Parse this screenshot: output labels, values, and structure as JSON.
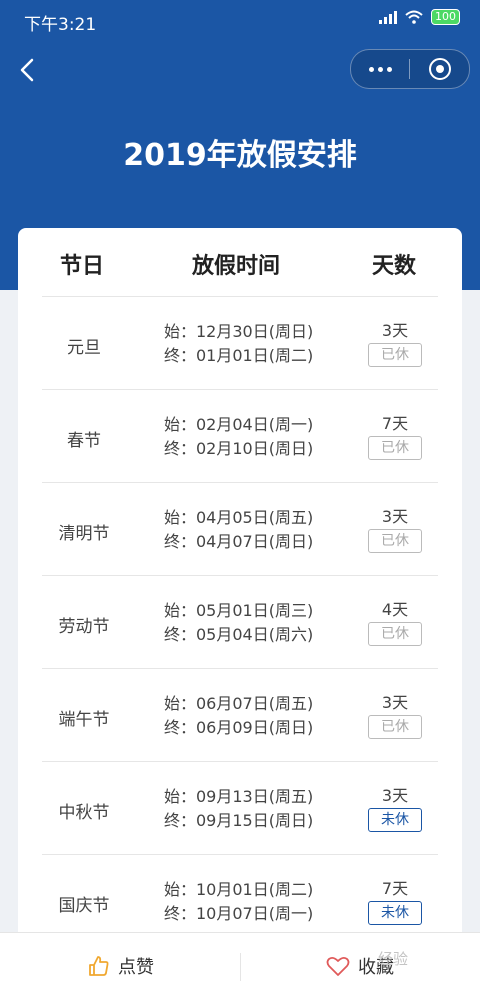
{
  "status": {
    "time": "下午3:21",
    "battery": "100"
  },
  "page": {
    "title": "2019年放假安排"
  },
  "table": {
    "headers": [
      "节日",
      "放假时间",
      "天数"
    ],
    "rows": [
      {
        "name": "元旦",
        "start": "始：12月30日(周日)",
        "end": "终：01月01日(周二)",
        "days": "3天",
        "status": "已休",
        "pending": false
      },
      {
        "name": "春节",
        "start": "始：02月04日(周一)",
        "end": "终：02月10日(周日)",
        "days": "7天",
        "status": "已休",
        "pending": false
      },
      {
        "name": "清明节",
        "start": "始：04月05日(周五)",
        "end": "终：04月07日(周日)",
        "days": "3天",
        "status": "已休",
        "pending": false
      },
      {
        "name": "劳动节",
        "start": "始：05月01日(周三)",
        "end": "终：05月04日(周六)",
        "days": "4天",
        "status": "已休",
        "pending": false
      },
      {
        "name": "端午节",
        "start": "始：06月07日(周五)",
        "end": "终：06月09日(周日)",
        "days": "3天",
        "status": "已休",
        "pending": false
      },
      {
        "name": "中秋节",
        "start": "始：09月13日(周五)",
        "end": "终：09月15日(周日)",
        "days": "3天",
        "status": "未休",
        "pending": true
      },
      {
        "name": "国庆节",
        "start": "始：10月01日(周二)",
        "end": "终：10月07日(周一)",
        "days": "7天",
        "status": "未休",
        "pending": true
      }
    ]
  },
  "bottom": {
    "like_label": "点赞",
    "favorite_label": "收藏"
  },
  "watermark": "经验",
  "colors": {
    "brand": "#1b56a5",
    "accent": "#f0a830",
    "heart": "#e05a5a"
  },
  "icons": {
    "back": "chevron-left-icon",
    "more": "more-dots-icon",
    "close": "target-close-icon",
    "like": "thumbs-up-icon",
    "favorite": "heart-icon"
  }
}
